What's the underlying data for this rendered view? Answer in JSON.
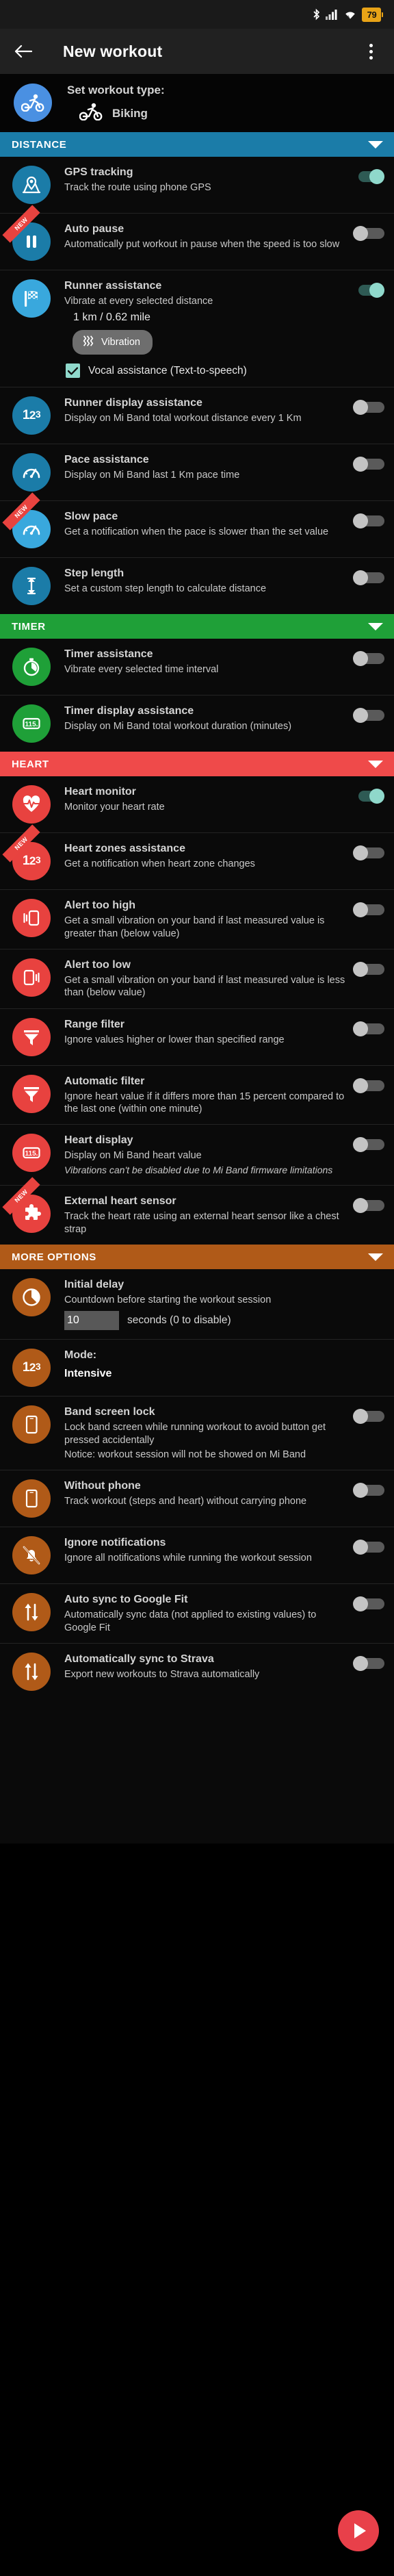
{
  "statusbar": {
    "battery_level": "79",
    "icons": [
      "bluetooth-icon",
      "cellular-signal-icon",
      "wifi-icon",
      "battery-icon"
    ]
  },
  "appbar": {
    "title": "New workout",
    "back_label": "Back",
    "overflow_label": "More options"
  },
  "workout_type": {
    "label": "Set workout type:",
    "value": "Biking",
    "accent": "#4a90e2"
  },
  "sections": [
    {
      "id": "distance",
      "title": "DISTANCE",
      "color": "#1b7ca8",
      "icon_color": "#1b7ca8",
      "rows": [
        {
          "title": "GPS tracking",
          "sub": "Track the route using phone GPS",
          "toggle": "on",
          "icon": "location-pin-map-icon",
          "icon_color": "#1b7ca8",
          "badge": ""
        },
        {
          "title": "Auto pause",
          "sub": "Automatically put workout in pause when the speed is too slow",
          "toggle": "off",
          "icon": "pause-icon",
          "icon_color": "#1b7ca8",
          "badge": "NEW"
        },
        {
          "title": "Runner assistance",
          "sub": "Vibrate at every selected distance",
          "value": "1 km / 0.62 mile",
          "chip": "Vibration",
          "chip_icon": "vibration-waves-icon",
          "checkbox": {
            "label": "Vocal assistance (Text-to-speech)",
            "checked": true
          },
          "toggle": "on",
          "icon": "checkered-flag-icon",
          "icon_color": "#39a8dd",
          "badge": ""
        },
        {
          "title": "Runner display assistance",
          "sub": "Display on Mi Band total workout distance every 1 Km",
          "toggle": "off",
          "icon": "numbers-123-icon",
          "icon_color": "#1b7ca8",
          "badge": ""
        },
        {
          "title": "Pace assistance",
          "sub": "Display on Mi Band last 1 Km pace time",
          "toggle": "off",
          "icon": "speedometer-icon",
          "icon_color": "#1b7ca8",
          "badge": ""
        },
        {
          "title": "Slow pace",
          "sub": "Get a notification when the pace is slower than the set value",
          "toggle": "off",
          "icon": "speedometer-icon",
          "icon_color": "#39a8dd",
          "badge": "NEW"
        },
        {
          "title": "Step length",
          "sub": "Set a custom step length to calculate distance",
          "toggle": "off",
          "icon": "vertical-arrows-icon",
          "icon_color": "#1b7ca8",
          "badge": ""
        }
      ]
    },
    {
      "id": "timer",
      "title": "TIMER",
      "color": "#1fa038",
      "rows": [
        {
          "title": "Timer assistance",
          "sub": "Vibrate every selected time interval",
          "toggle": "off",
          "icon": "stopwatch-icon",
          "icon_color": "#1fa038",
          "badge": ""
        },
        {
          "title": "Timer display assistance",
          "sub": "Display on Mi Band total workout duration (minutes)",
          "toggle": "off",
          "icon": "band-number-display-icon",
          "icon_color": "#1fa038",
          "badge": ""
        }
      ]
    },
    {
      "id": "heart",
      "title": "HEART",
      "color": "#ef4a4a",
      "rows": [
        {
          "title": "Heart monitor",
          "sub": "Monitor your heart rate",
          "toggle": "on",
          "icon": "heart-pulse-icon",
          "icon_color": "#e8423f",
          "badge": ""
        },
        {
          "title": "Heart zones assistance",
          "sub": "Get a notification when heart zone changes",
          "toggle": "off",
          "icon": "numbers-123-icon",
          "icon_color": "#e8423f",
          "badge": "NEW"
        },
        {
          "title": "Alert too high",
          "sub": "Get a small vibration on your band if last measured value is greater than (below value)",
          "toggle": "off",
          "icon": "vibrate-left-icon",
          "icon_color": "#e8423f",
          "badge": ""
        },
        {
          "title": "Alert too low",
          "sub": "Get a small vibration on your band if last measured value is less than (below value)",
          "toggle": "off",
          "icon": "vibrate-right-icon",
          "icon_color": "#e8423f",
          "badge": ""
        },
        {
          "title": "Range filter",
          "sub": "Ignore values higher or lower than specified range",
          "toggle": "off",
          "icon": "funnel-filter-icon",
          "icon_color": "#e8423f",
          "badge": ""
        },
        {
          "title": "Automatic filter",
          "sub": "Ignore heart value if it differs more than 15 percent compared to the last one (within one minute)",
          "toggle": "off",
          "icon": "funnel-filter-icon",
          "icon_color": "#e8423f",
          "badge": ""
        },
        {
          "title": "Heart display",
          "sub": "Display on Mi Band heart value",
          "note": "Vibrations can't be disabled due to Mi Band firmware limitations",
          "toggle": "off",
          "icon": "band-number-display-icon",
          "icon_color": "#e8423f",
          "badge": ""
        },
        {
          "title": "External heart sensor",
          "sub": "Track the heart rate using an external heart sensor like a chest strap",
          "toggle": "off",
          "icon": "puzzle-piece-icon",
          "icon_color": "#e8423f",
          "badge": "NEW"
        }
      ]
    },
    {
      "id": "more-options",
      "title": "MORE OPTIONS",
      "color": "#b05a18",
      "rows": [
        {
          "title": "Initial delay",
          "sub": "Countdown before starting the workout session",
          "input_value": "10",
          "input_after": "seconds (0 to disable)",
          "icon": "countdown-timer-icon",
          "icon_color": "#b05a18",
          "badge": ""
        },
        {
          "title": "Mode:",
          "strong": "Intensive",
          "icon": "numbers-123-icon",
          "icon_color": "#b05a18",
          "badge": ""
        },
        {
          "title": "Band screen lock",
          "sub": "Lock band screen while running workout to avoid button get pressed accidentally",
          "sub2": "Notice: workout session will not be showed on Mi Band",
          "toggle": "off",
          "icon": "phone-icon",
          "icon_color": "#b05a18",
          "badge": ""
        },
        {
          "title": "Without phone",
          "sub": "Track workout (steps and heart) without carrying phone",
          "toggle": "off",
          "icon": "phone-icon",
          "icon_color": "#b05a18",
          "badge": ""
        },
        {
          "title": "Ignore notifications",
          "sub": "Ignore all notifications while running the workout session",
          "toggle": "off",
          "icon": "bell-off-icon",
          "icon_color": "#b05a18",
          "badge": ""
        },
        {
          "title": "Auto sync to Google Fit",
          "sub": "Automatically sync data (not applied to existing values) to Google Fit",
          "toggle": "off",
          "icon": "sync-arrows-icon",
          "icon_color": "#b05a18",
          "badge": ""
        },
        {
          "title": "Automatically sync to Strava",
          "sub": "Export new workouts to Strava automatically",
          "toggle": "off",
          "icon": "sync-arrows-icon",
          "icon_color": "#b05a18",
          "badge": ""
        }
      ]
    }
  ],
  "fab": {
    "label": "Start workout",
    "color": "#e8404a",
    "icon": "play-icon"
  }
}
